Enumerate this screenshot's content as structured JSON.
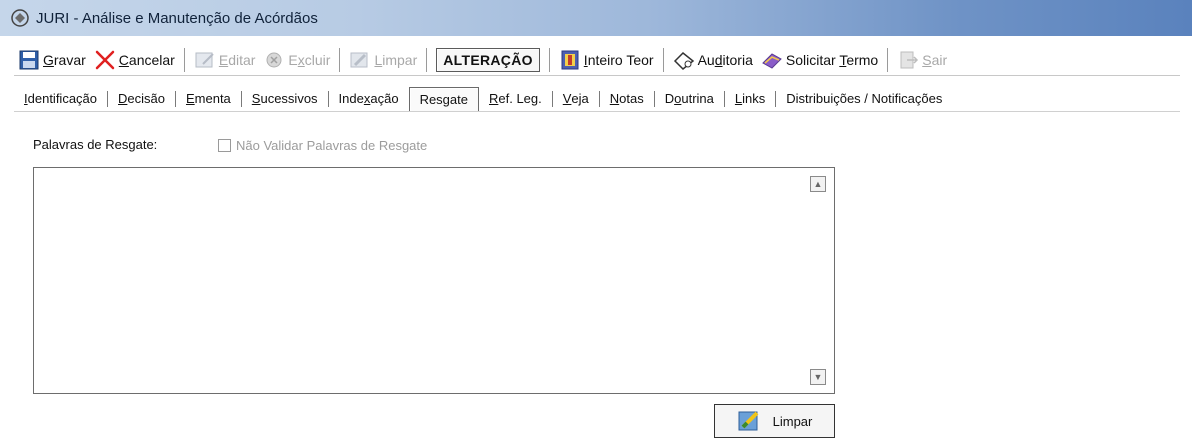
{
  "window": {
    "title": "JURI - Análise e Manutenção de Acórdãos"
  },
  "toolbar": {
    "gravar": {
      "pre": "",
      "u": "G",
      "post": "ravar"
    },
    "cancelar": {
      "pre": "",
      "u": "C",
      "post": "ancelar"
    },
    "editar": {
      "pre": "",
      "u": "E",
      "post": "ditar"
    },
    "excluir": {
      "pre": "E",
      "u": "x",
      "post": "cluir"
    },
    "limpar": {
      "pre": "",
      "u": "L",
      "post": "impar"
    },
    "mode": "ALTERAÇÃO",
    "inteiro_teor": {
      "pre": "",
      "u": "I",
      "post": "nteiro Teor"
    },
    "auditoria": {
      "pre": "Au",
      "u": "d",
      "post": "itoria"
    },
    "solicitar": {
      "pre": "Solicitar ",
      "u": "T",
      "post": "ermo"
    },
    "sair": {
      "pre": "",
      "u": "S",
      "post": "air"
    }
  },
  "tabs": [
    {
      "pre": "",
      "u": "I",
      "post": "dentificação"
    },
    {
      "pre": "",
      "u": "D",
      "post": "ecisão"
    },
    {
      "pre": "",
      "u": "E",
      "post": "menta"
    },
    {
      "pre": "",
      "u": "S",
      "post": "ucessivos"
    },
    {
      "pre": "Inde",
      "u": "x",
      "post": "ação"
    },
    {
      "pre": "",
      "u": "",
      "post": "Resgate"
    },
    {
      "pre": "",
      "u": "R",
      "post": "ef. Leg."
    },
    {
      "pre": "",
      "u": "V",
      "post": "eja"
    },
    {
      "pre": "",
      "u": "N",
      "post": "otas"
    },
    {
      "pre": "D",
      "u": "o",
      "post": "utrina"
    },
    {
      "pre": "",
      "u": "L",
      "post": "inks"
    },
    {
      "pre": "",
      "u": "",
      "post": "Distribuições / Notificações"
    }
  ],
  "form": {
    "label": "Palavras de Resgate:",
    "checkbox_label": "Não Validar Palavras de Resgate",
    "checkbox_checked": false,
    "textarea_value": "",
    "limpar_button": "Limpar"
  }
}
